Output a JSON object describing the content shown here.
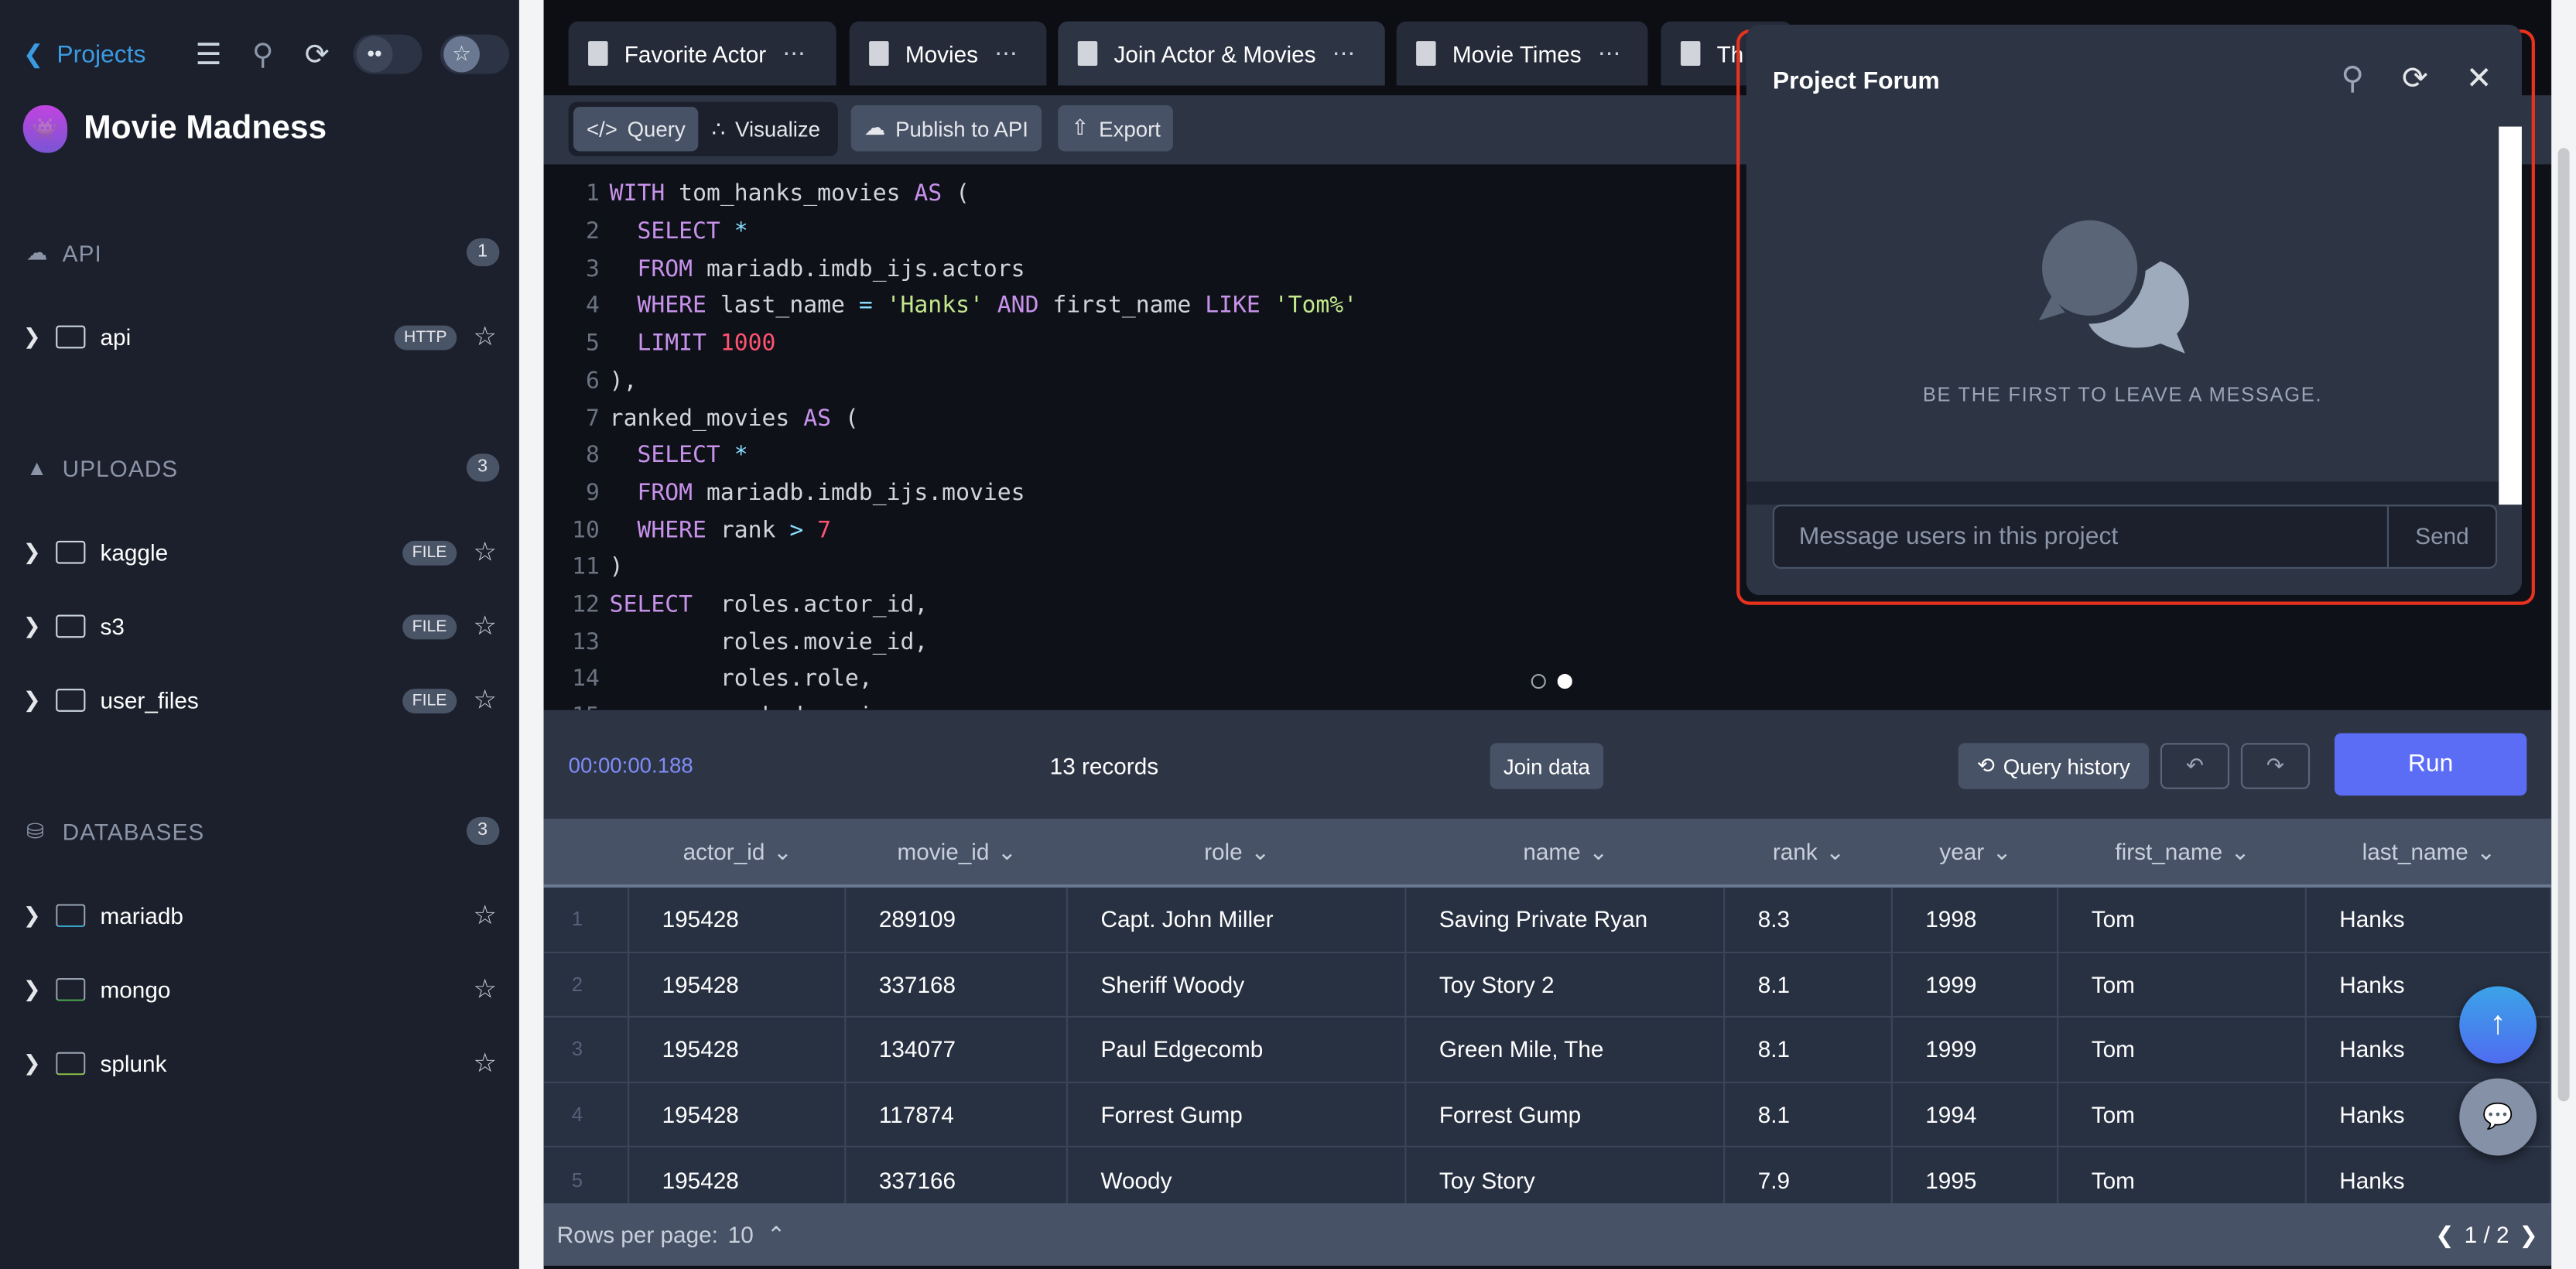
{
  "sidebar": {
    "back_label": "Projects",
    "project_name": "Movie Madness",
    "sections": [
      {
        "title": "API",
        "count": "1",
        "items": [
          {
            "name": "api",
            "badge": "HTTP"
          }
        ]
      },
      {
        "title": "UPLOADS",
        "count": "3",
        "items": [
          {
            "name": "kaggle",
            "badge": "FILE"
          },
          {
            "name": "s3",
            "badge": "FILE"
          },
          {
            "name": "user_files",
            "badge": "FILE"
          }
        ]
      },
      {
        "title": "DATABASES",
        "count": "3",
        "items": [
          {
            "name": "mariadb"
          },
          {
            "name": "mongo"
          },
          {
            "name": "splunk"
          }
        ]
      }
    ]
  },
  "tabs": [
    {
      "label": "Favorite Actor"
    },
    {
      "label": "Movies"
    },
    {
      "label": "Join Actor & Movies"
    },
    {
      "label": "Movie Times"
    },
    {
      "label": "Th"
    }
  ],
  "toolbar": {
    "query": "Query",
    "visualize": "Visualize",
    "publish": "Publish to API",
    "export": "Export"
  },
  "editor": {
    "lines": [
      [
        [
          "kw",
          "WITH "
        ],
        [
          "id",
          "tom_hanks_movies "
        ],
        [
          "kw",
          "AS "
        ],
        [
          "id",
          "("
        ]
      ],
      [
        [
          "kw",
          "  SELECT "
        ],
        [
          "op",
          "*"
        ]
      ],
      [
        [
          "kw",
          "  FROM "
        ],
        [
          "id",
          "mariadb.imdb_ijs.actors"
        ]
      ],
      [
        [
          "kw",
          "  WHERE "
        ],
        [
          "id",
          "last_name "
        ],
        [
          "op",
          "= "
        ],
        [
          "str",
          "'Hanks' "
        ],
        [
          "kw",
          "AND "
        ],
        [
          "id",
          "first_name "
        ],
        [
          "kw",
          "LIKE "
        ],
        [
          "str",
          "'Tom%'"
        ]
      ],
      [
        [
          "kw",
          "  LIMIT "
        ],
        [
          "nm",
          "1000"
        ]
      ],
      [
        [
          "id",
          "),"
        ]
      ],
      [
        [
          "id",
          "ranked_movies "
        ],
        [
          "kw",
          "AS "
        ],
        [
          "id",
          "("
        ]
      ],
      [
        [
          "kw",
          "  SELECT "
        ],
        [
          "op",
          "*"
        ]
      ],
      [
        [
          "kw",
          "  FROM "
        ],
        [
          "id",
          "mariadb.imdb_ijs.movies"
        ]
      ],
      [
        [
          "kw",
          "  WHERE "
        ],
        [
          "id",
          "rank "
        ],
        [
          "op",
          "> "
        ],
        [
          "nm",
          "7"
        ]
      ],
      [
        [
          "id",
          ")"
        ]
      ],
      [
        [
          "kw",
          "SELECT  "
        ],
        [
          "id",
          "roles.actor_id,"
        ]
      ],
      [
        [
          "id",
          "        roles.movie_id,"
        ]
      ],
      [
        [
          "id",
          "        roles.role,"
        ]
      ],
      [
        [
          "id",
          "        ranked_movies.name,"
        ]
      ]
    ]
  },
  "results": {
    "elapsed": "00:00:00.188",
    "records": "13 records",
    "join": "Join data",
    "history": "Query history",
    "run": "Run"
  },
  "table": {
    "columns": [
      "actor_id",
      "movie_id",
      "role",
      "name",
      "rank",
      "year",
      "first_name",
      "last_name"
    ],
    "rows": [
      [
        "1",
        "195428",
        "289109",
        "Capt. John Miller",
        "Saving Private Ryan",
        "8.3",
        "1998",
        "Tom",
        "Hanks"
      ],
      [
        "2",
        "195428",
        "337168",
        "Sheriff Woody",
        "Toy Story 2",
        "8.1",
        "1999",
        "Tom",
        "Hanks"
      ],
      [
        "3",
        "195428",
        "134077",
        "Paul Edgecomb",
        "Green Mile, The",
        "8.1",
        "1999",
        "Tom",
        "Hanks"
      ],
      [
        "4",
        "195428",
        "117874",
        "Forrest Gump",
        "Forrest Gump",
        "8.1",
        "1994",
        "Tom",
        "Hanks"
      ],
      [
        "5",
        "195428",
        "337166",
        "Woody",
        "Toy Story",
        "7.9",
        "1995",
        "Tom",
        "Hanks"
      ]
    ],
    "rows_per_page_label": "Rows per page:",
    "rows_per_page": "10",
    "page": "1 / 2"
  },
  "forum": {
    "title": "Project Forum",
    "empty": "BE THE FIRST TO LEAVE A MESSAGE.",
    "placeholder": "Message users in this project",
    "send": "Send"
  }
}
